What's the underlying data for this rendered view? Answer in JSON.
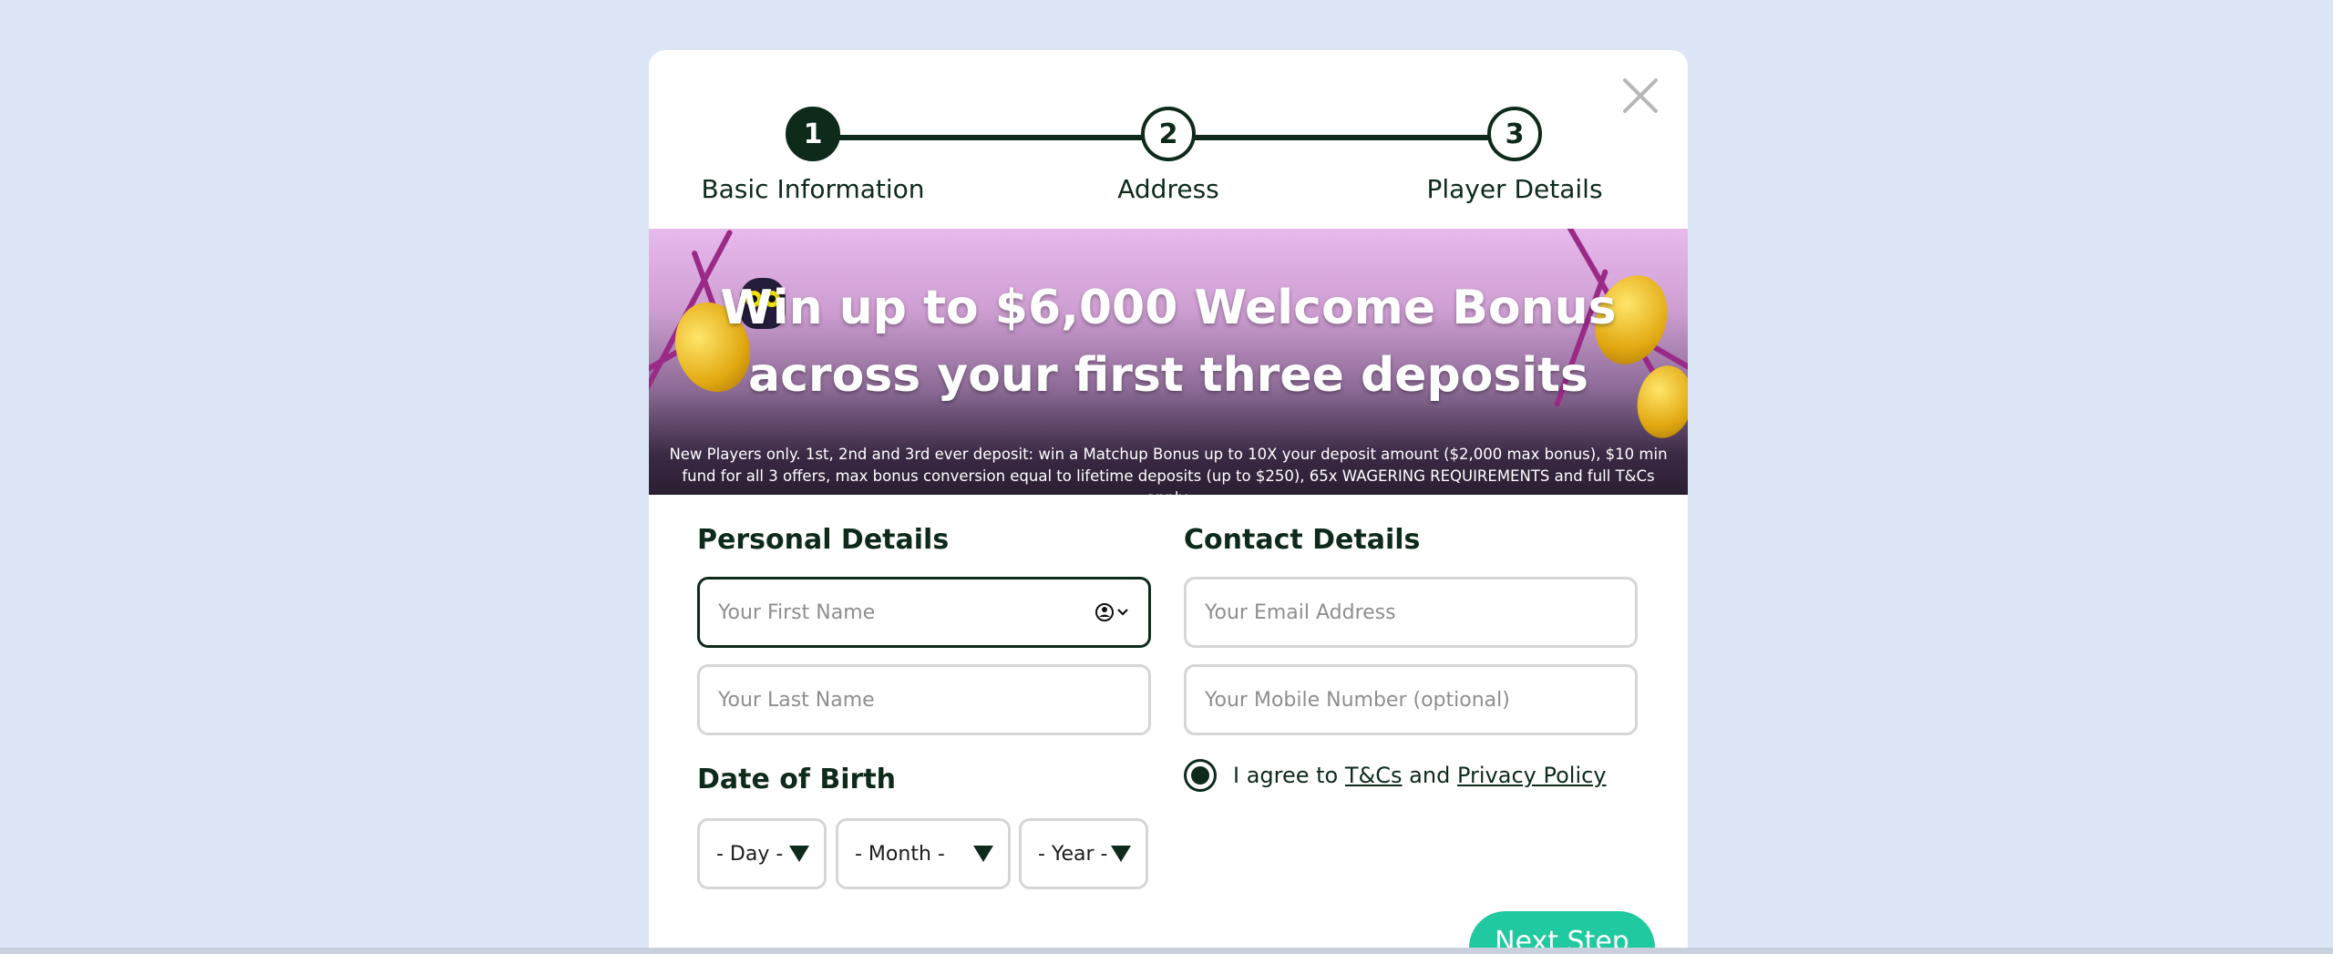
{
  "brand": {
    "logo_text": ""
  },
  "stepper": {
    "steps": [
      {
        "number": "1",
        "label": "Basic Information",
        "active": true
      },
      {
        "number": "2",
        "label": "Address",
        "active": false
      },
      {
        "number": "3",
        "label": "Player Details",
        "active": false
      }
    ]
  },
  "banner": {
    "title_line1": "Win up to $6,000 Welcome Bonus",
    "title_line2": "across your first three deposits",
    "terms": "New Players only. 1st, 2nd and 3rd ever deposit: win a Matchup Bonus up to 10X your deposit amount ($2,000 max bonus), $10 min fund for all 3 offers, max bonus conversion equal to lifetime deposits (up to $250), 65x WAGERING REQUIREMENTS and full T&Cs apply."
  },
  "personal": {
    "title": "Personal Details",
    "first_name_placeholder": "Your First Name",
    "last_name_placeholder": "Your Last Name"
  },
  "dob": {
    "title": "Date of Birth",
    "day": "- Day -",
    "month": "- Month -",
    "year": "- Year -"
  },
  "contact": {
    "title": "Contact Details",
    "email_placeholder": "Your Email Address",
    "mobile_placeholder": "Your Mobile Number (optional)"
  },
  "agree": {
    "prefix": "I agree to",
    "tcs": "T&Cs",
    "and": "and",
    "privacy": "Privacy Policy",
    "checked": true
  },
  "actions": {
    "next_label": "Next Step"
  },
  "colors": {
    "primary": "#0d2a1b",
    "accent": "#21c9a0",
    "background": "#dde6f7",
    "brand": "#a31fb8"
  }
}
